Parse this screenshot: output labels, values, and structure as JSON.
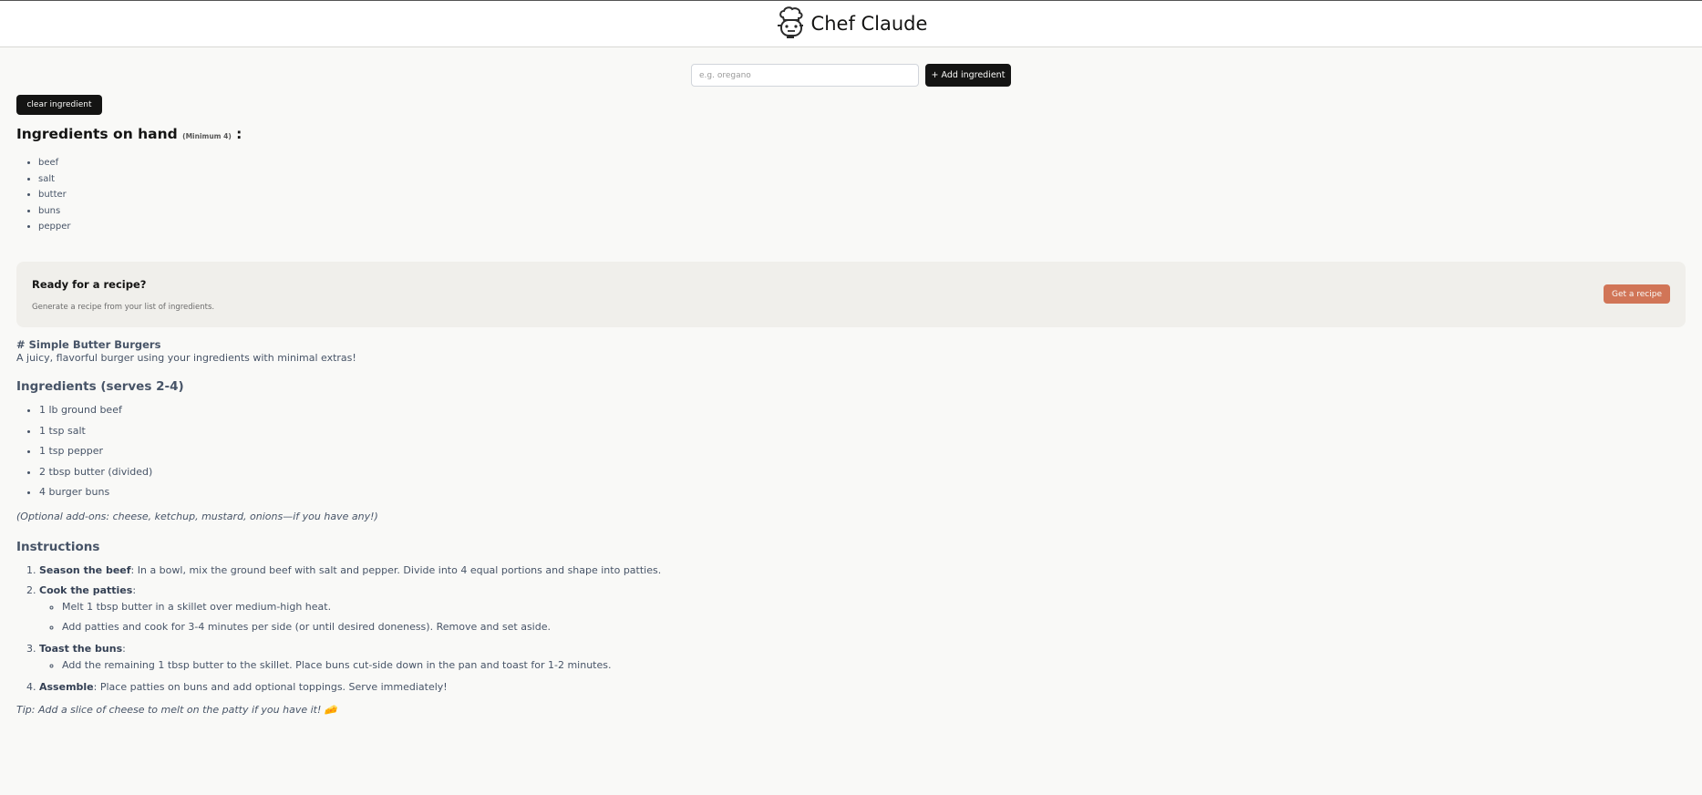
{
  "header": {
    "title": "Chef Claude",
    "logo_icon": "chef-robot-icon"
  },
  "add_form": {
    "placeholder": "e.g. oregano",
    "value": "",
    "add_label": "+ Add ingredient"
  },
  "clear_label": "clear ingredient",
  "ingredients_on_hand": {
    "heading": "Ingredients on hand",
    "note": "(Minimum 4)",
    "suffix": ":",
    "items": [
      "beef",
      "salt",
      "butter",
      "buns",
      "pepper"
    ]
  },
  "cta": {
    "title": "Ready for a recipe?",
    "subtitle": "Generate a recipe from your list of ingredients.",
    "button_label": "Get a recipe"
  },
  "recipe": {
    "title": "# Simple Butter Burgers",
    "description": "A juicy, flavorful burger using your ingredients with minimal extras!",
    "ingredients_heading": "Ingredients (serves 2-4)",
    "ingredients": [
      "1 lb ground beef",
      "1 tsp salt",
      "1 tsp pepper",
      "2 tbsp butter (divided)",
      "4 burger buns"
    ],
    "optional": "(Optional add-ons: cheese, ketchup, mustard, onions—if you have any!)",
    "instructions_heading": "Instructions",
    "steps": [
      {
        "bold": "Season the beef",
        "text": ": In a bowl, mix the ground beef with salt and pepper. Divide into 4 equal portions and shape into patties.",
        "sub": []
      },
      {
        "bold": "Cook the patties",
        "text": ":",
        "sub": [
          "Melt 1 tbsp butter in a skillet over medium-high heat.",
          "Add patties and cook for 3-4 minutes per side (or until desired doneness). Remove and set aside."
        ]
      },
      {
        "bold": "Toast the buns",
        "text": ":",
        "sub": [
          "Add the remaining 1 tbsp butter to the skillet. Place buns cut-side down in the pan and toast for 1-2 minutes."
        ]
      },
      {
        "bold": "Assemble",
        "text": ": Place patties on buns and add optional toppings. Serve immediately!",
        "sub": []
      }
    ],
    "tip": "Tip: Add a slice of cheese to melt on the patty if you have it! 🧀"
  },
  "colors": {
    "background": "#f9f9f7",
    "dark_button": "#141413",
    "accent_button": "#d17557",
    "recipe_text": "#475467"
  }
}
